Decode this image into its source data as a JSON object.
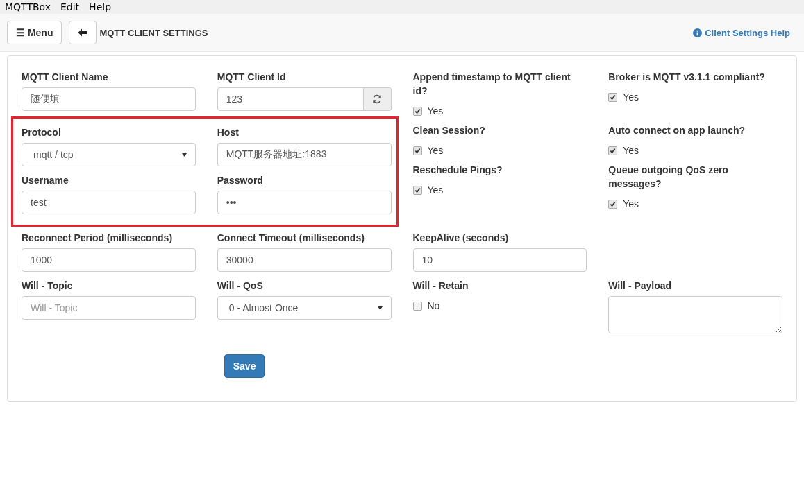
{
  "menu_bar": [
    "MQTTBox",
    "Edit",
    "Help"
  ],
  "toolbar": {
    "menu_button": "☰ Menu",
    "title": "MQTT CLIENT SETTINGS",
    "help_link": "Client Settings Help"
  },
  "form": {
    "top": [
      {
        "kind": "text",
        "label": "MQTT Client Name",
        "value": "随便填"
      },
      {
        "kind": "text_refresh",
        "label": "MQTT Client Id",
        "value": "123"
      },
      {
        "kind": "checkbox",
        "label": "Append timestamp to MQTT client id?",
        "option": "Yes",
        "checked": true
      },
      {
        "kind": "checkbox",
        "label": "Broker is MQTT v3.1.1 compliant?",
        "option": "Yes",
        "checked": true
      }
    ],
    "highlighted": [
      {
        "kind": "select",
        "label": "Protocol",
        "value": "mqtt / tcp"
      },
      {
        "kind": "text",
        "label": "Host",
        "value": "MQTT服务器地址:1883"
      },
      {
        "kind": "text",
        "label": "Username",
        "value": "test"
      },
      {
        "kind": "text",
        "label": "Password",
        "value": "•••"
      }
    ],
    "side": [
      {
        "kind": "checkbox",
        "label": "Clean Session?",
        "option": "Yes",
        "checked": true
      },
      {
        "kind": "checkbox",
        "label": "Auto connect on app launch?",
        "option": "Yes",
        "checked": true
      },
      {
        "kind": "checkbox",
        "label": "Reschedule Pings?",
        "option": "Yes",
        "checked": true
      },
      {
        "kind": "checkbox",
        "label": "Queue outgoing QoS zero messages?",
        "option": "Yes",
        "checked": true
      }
    ],
    "bottom": [
      {
        "kind": "text",
        "label": "Reconnect Period (milliseconds)",
        "value": "1000"
      },
      {
        "kind": "text",
        "label": "Connect Timeout (milliseconds)",
        "value": "30000"
      },
      {
        "kind": "text",
        "label": "KeepAlive (seconds)",
        "value": "10"
      },
      {
        "kind": "empty"
      },
      {
        "kind": "text",
        "label": "Will - Topic",
        "placeholder": "Will - Topic"
      },
      {
        "kind": "select",
        "label": "Will - QoS",
        "value": "0 - Almost Once"
      },
      {
        "kind": "checkbox",
        "label": "Will - Retain",
        "option": "No",
        "checked": false
      },
      {
        "kind": "textarea",
        "label": "Will - Payload"
      }
    ],
    "save_button": "Save"
  }
}
